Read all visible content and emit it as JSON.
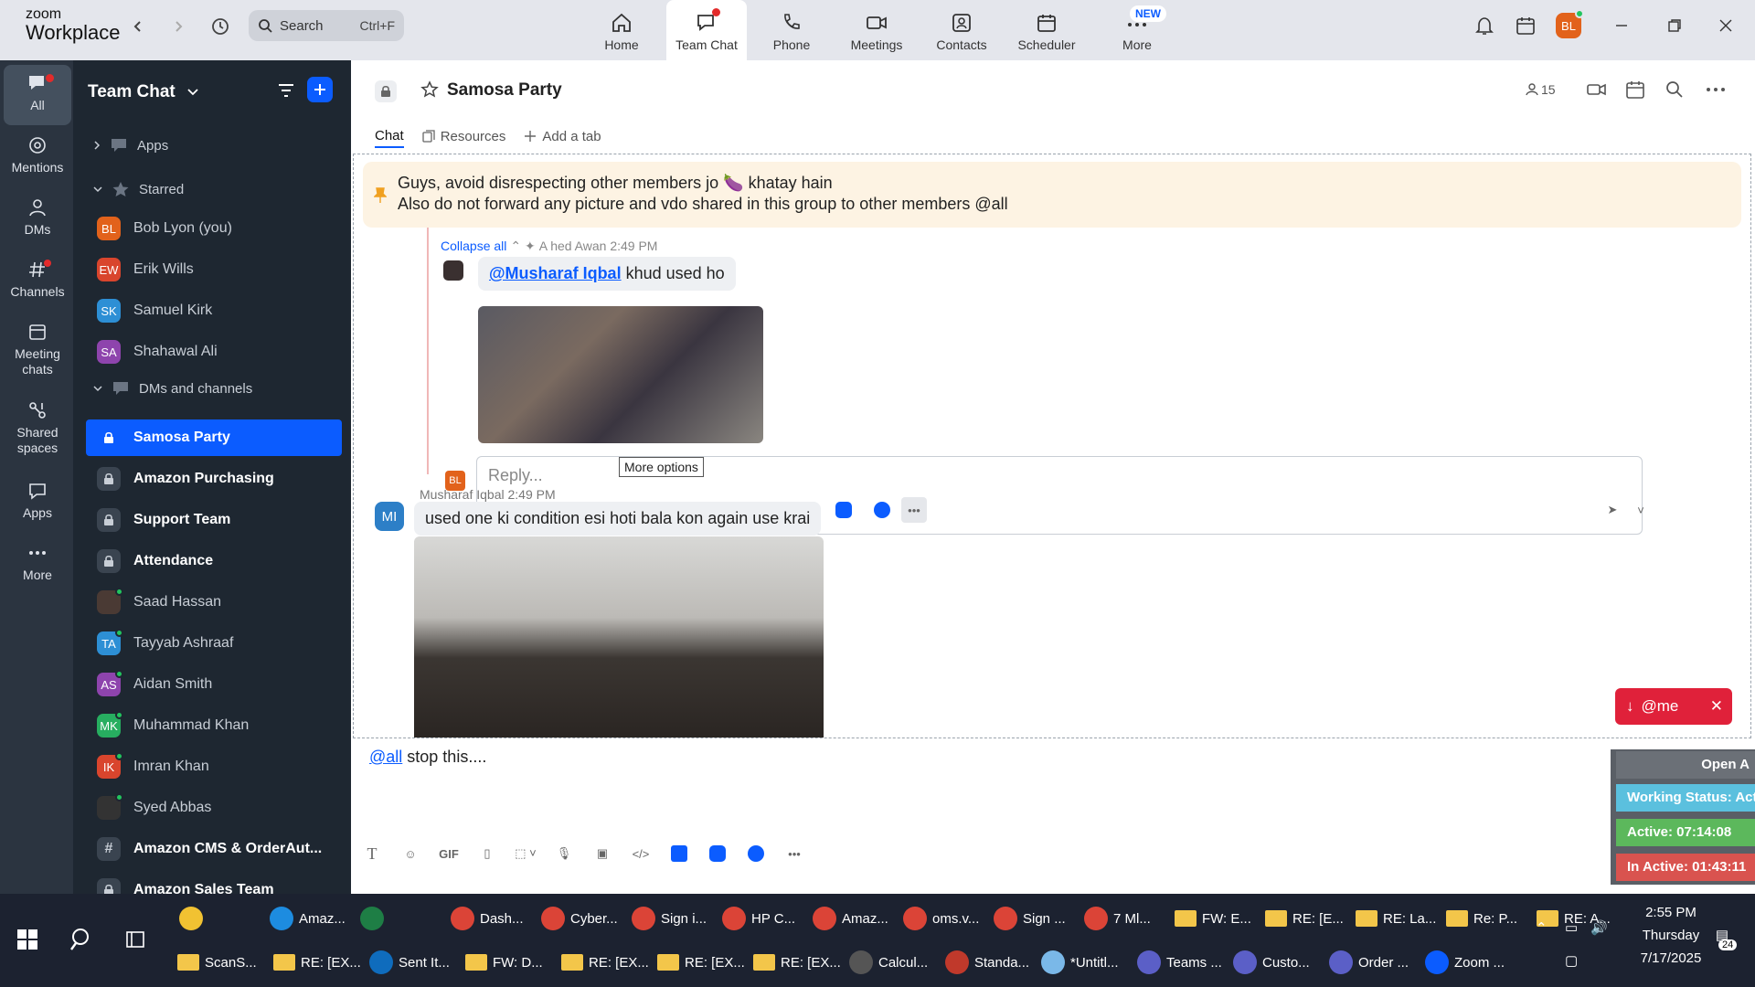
{
  "app": {
    "logo_line1": "zoom",
    "logo_line2": "Workplace",
    "accent": "#0b5cff",
    "search_label": "Search",
    "search_shortcut": "Ctrl+F",
    "user_initials": "BL",
    "nav": [
      {
        "label": "Home",
        "icon": "home-icon"
      },
      {
        "label": "Team Chat",
        "icon": "team-chat-icon"
      },
      {
        "label": "Phone",
        "icon": "phone-icon"
      },
      {
        "label": "Meetings",
        "icon": "meetings-icon"
      },
      {
        "label": "Contacts",
        "icon": "contacts-icon"
      },
      {
        "label": "Scheduler",
        "icon": "scheduler-icon"
      },
      {
        "label": "More",
        "icon": "more-icon"
      }
    ],
    "new_badge": "NEW"
  },
  "rail": [
    {
      "label": "All"
    },
    {
      "label": "Mentions"
    },
    {
      "label": "DMs"
    },
    {
      "label": "Channels"
    },
    {
      "label": "Meeting chats"
    },
    {
      "label": "Shared spaces"
    },
    {
      "label": "Apps"
    },
    {
      "label": "More"
    }
  ],
  "sidebar": {
    "title": "Team Chat",
    "apps_label": "Apps",
    "starred_label": "Starred",
    "dms_label": "DMs and channels",
    "starred": [
      {
        "initials": "BL",
        "name": "Bob Lyon (you)",
        "color": "#e2621b"
      },
      {
        "initials": "EW",
        "name": "Erik Wills",
        "color": "#d9452d"
      },
      {
        "initials": "SK",
        "name": "Samuel Kirk",
        "color": "#2d8fd5"
      },
      {
        "initials": "SA",
        "name": "Shahawal Ali",
        "color": "#8e44ad"
      }
    ],
    "channels": [
      {
        "type": "lock",
        "name": "Samosa Party",
        "selected": true
      },
      {
        "type": "lock",
        "name": "Amazon Purchasing"
      },
      {
        "type": "lock",
        "name": "Support Team"
      },
      {
        "type": "lock",
        "name": "Attendance"
      },
      {
        "type": "photo",
        "name": "Saad Hassan"
      },
      {
        "type": "avatar",
        "initials": "TA",
        "name": "Tayyab Ashraaf",
        "color": "#2d8fd5"
      },
      {
        "type": "avatar",
        "initials": "AS",
        "name": "Aidan Smith",
        "color": "#8e44ad"
      },
      {
        "type": "avatar",
        "initials": "MK",
        "name": "Muhammad Khan",
        "color": "#27ae60"
      },
      {
        "type": "avatar",
        "initials": "IK",
        "name": "Imran Khan",
        "color": "#d9452d"
      },
      {
        "type": "photo",
        "name": "Syed Abbas"
      },
      {
        "type": "hash",
        "name": "Amazon CMS & OrderAut..."
      },
      {
        "type": "lock",
        "name": "Amazon Sales Team"
      }
    ]
  },
  "channel": {
    "name": "Samosa Party",
    "member_count": "15",
    "tabs": [
      "Chat",
      "Resources",
      "Add a tab"
    ]
  },
  "pinned": {
    "line1": "Guys, avoid disrespecting other members jo 🍆 khatay hain",
    "line2": "Also do not forward any picture and vdo shared in this group to other members @all"
  },
  "thread": {
    "collapse_label": "Collapse all",
    "sender_header": "A hed Awan 2:49 PM",
    "mention": "@Musharaf Iqbal",
    "message_tail": " khud used ho",
    "reply_placeholder": "Reply...",
    "my_initials": "BL",
    "tooltip": "More options"
  },
  "message2": {
    "initials": "MI",
    "sender": "Musharaf Iqbal",
    "time": "2:49 PM",
    "text": "used one  ki condition esi hoti bala kon again use krai"
  },
  "at_me_label": "@me",
  "composer": {
    "mention": "@all",
    "text": " stop this...."
  },
  "status_widget": {
    "open": "Open A",
    "working": "Working Status: Acti",
    "active": "Active: 07:14:08",
    "inactive": "In Active: 01:43:11"
  },
  "taskbar": {
    "row1": [
      {
        "label": "",
        "icon": "file-explorer-icon",
        "color": "#f1c232"
      },
      {
        "label": "Amaz...",
        "icon": "edge-icon",
        "color": "#1d8ce0"
      },
      {
        "label": "",
        "icon": "excel-icon",
        "color": "#1e7e45"
      },
      {
        "label": "Dash...",
        "icon": "chrome-icon",
        "color": "#db4437"
      },
      {
        "label": "Cyber...",
        "icon": "chrome-icon",
        "color": "#db4437"
      },
      {
        "label": "Sign i...",
        "icon": "chrome-icon",
        "color": "#db4437"
      },
      {
        "label": "HP C...",
        "icon": "chrome-icon",
        "color": "#db4437"
      },
      {
        "label": "Amaz...",
        "icon": "chrome-icon",
        "color": "#db4437"
      },
      {
        "label": "oms.v...",
        "icon": "chrome-icon",
        "color": "#db4437"
      },
      {
        "label": "Sign ...",
        "icon": "chrome-icon",
        "color": "#db4437"
      },
      {
        "label": "7 Ml...",
        "icon": "chrome-icon",
        "color": "#db4437"
      },
      {
        "label": "FW: E...",
        "icon": "mail-icon",
        "color": "#f3c64a"
      },
      {
        "label": "RE: [E...",
        "icon": "mail-icon",
        "color": "#f3c64a"
      },
      {
        "label": "RE: La...",
        "icon": "mail-icon",
        "color": "#f3c64a"
      },
      {
        "label": "Re: P...",
        "icon": "mail-icon",
        "color": "#f3c64a"
      },
      {
        "label": "RE: A...",
        "icon": "mail-icon",
        "color": "#f3c64a"
      }
    ],
    "row2": [
      {
        "label": "ScanS...",
        "icon": "mail-icon",
        "color": "#f3c64a"
      },
      {
        "label": "RE: [EX...",
        "icon": "mail-icon",
        "color": "#f3c64a"
      },
      {
        "label": "Sent It...",
        "icon": "outlook-icon",
        "color": "#0f6cbd"
      },
      {
        "label": "FW: D...",
        "icon": "mail-icon",
        "color": "#f3c64a"
      },
      {
        "label": "RE: [EX...",
        "icon": "mail-icon",
        "color": "#f3c64a"
      },
      {
        "label": "RE: [EX...",
        "icon": "mail-icon",
        "color": "#f3c64a"
      },
      {
        "label": "RE: [EX...",
        "icon": "mail-icon",
        "color": "#f3c64a"
      },
      {
        "label": "Calcul...",
        "icon": "calculator-icon",
        "color": "#555"
      },
      {
        "label": "Standa...",
        "icon": "pdf-icon",
        "color": "#c0392b"
      },
      {
        "label": "*Untitl...",
        "icon": "notepad-icon",
        "color": "#7ab8e8"
      },
      {
        "label": "Teams ...",
        "icon": "teams-icon",
        "color": "#5b5fc7"
      },
      {
        "label": "Custo...",
        "icon": "teams-icon",
        "color": "#5b5fc7"
      },
      {
        "label": "Order ...",
        "icon": "teams-icon",
        "color": "#5b5fc7"
      },
      {
        "label": "Zoom ...",
        "icon": "zoom-icon",
        "color": "#0b5cff"
      }
    ],
    "time": "2:55 PM",
    "day": "Thursday",
    "date": "7/17/2025",
    "notif_count": "24"
  }
}
